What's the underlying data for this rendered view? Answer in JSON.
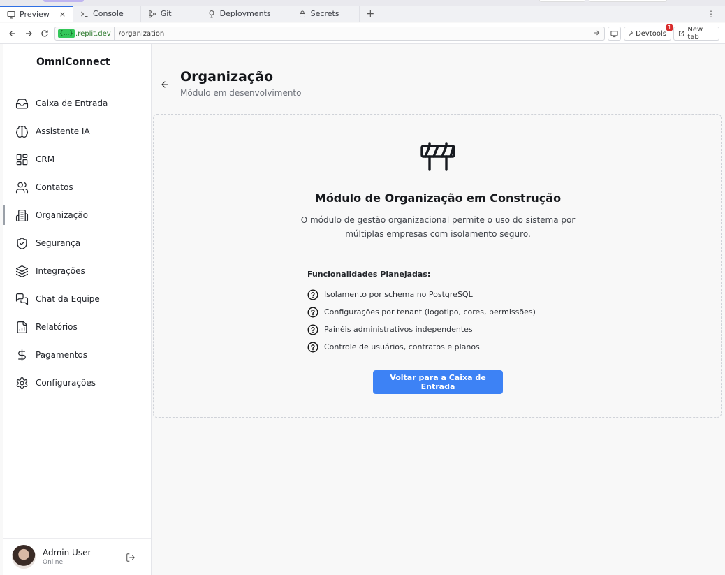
{
  "browser": {
    "tabs": [
      {
        "label": "Preview",
        "icon": "monitor-icon",
        "active": true
      },
      {
        "label": "Console",
        "icon": "terminal-icon"
      },
      {
        "label": "Git",
        "icon": "git-icon"
      },
      {
        "label": "Deployments",
        "icon": "deploy-icon"
      },
      {
        "label": "Secrets",
        "icon": "lock-icon"
      }
    ],
    "close_glyph": "×",
    "add_glyph": "+",
    "more_glyph": "⋮",
    "url_host_highlight": "{...}",
    "url_host": ".replit.dev",
    "url_path": "/organization",
    "devtools_label": "Devtools",
    "devtools_badge": "1",
    "new_tab_label": "New tab"
  },
  "sidebar": {
    "brand": "OmniConnect",
    "items": [
      {
        "label": "Caixa de Entrada",
        "icon": "inbox-icon"
      },
      {
        "label": "Assistente IA",
        "icon": "brain-icon"
      },
      {
        "label": "CRM",
        "icon": "layout-grid-icon"
      },
      {
        "label": "Contatos",
        "icon": "users-icon"
      },
      {
        "label": "Organização",
        "icon": "building-icon",
        "active": true
      },
      {
        "label": "Segurança",
        "icon": "shield-check-icon"
      },
      {
        "label": "Integrações",
        "icon": "layers-icon"
      },
      {
        "label": "Chat da Equipe",
        "icon": "messages-icon"
      },
      {
        "label": "Relatórios",
        "icon": "report-icon"
      },
      {
        "label": "Pagamentos",
        "icon": "dollar-icon"
      },
      {
        "label": "Configurações",
        "icon": "gear-icon"
      }
    ],
    "user": {
      "name": "Admin User",
      "status": "Online"
    }
  },
  "main": {
    "title": "Organização",
    "subtitle": "Módulo em desenvolvimento",
    "card": {
      "icon": "construction-barrier-icon",
      "title": "Módulo de Organização em Construção",
      "description": "O módulo de gestão organizacional permite o uso do sistema por múltiplas empresas com isolamento seguro.",
      "features_title": "Funcionalidades Planejadas:",
      "features": [
        "Isolamento por schema no PostgreSQL",
        "Configurações por tenant (logotipo, cores, permissões)",
        "Painéis administrativos independentes",
        "Controle de usuários, contratos e planos"
      ],
      "cta_label": "Voltar para a Caixa de Entrada"
    }
  },
  "colors": {
    "accent": "#3d82f5",
    "tab_active_border": "#2f6fe4",
    "badge": "#d92b2b",
    "url_highlight": "#34c759"
  }
}
